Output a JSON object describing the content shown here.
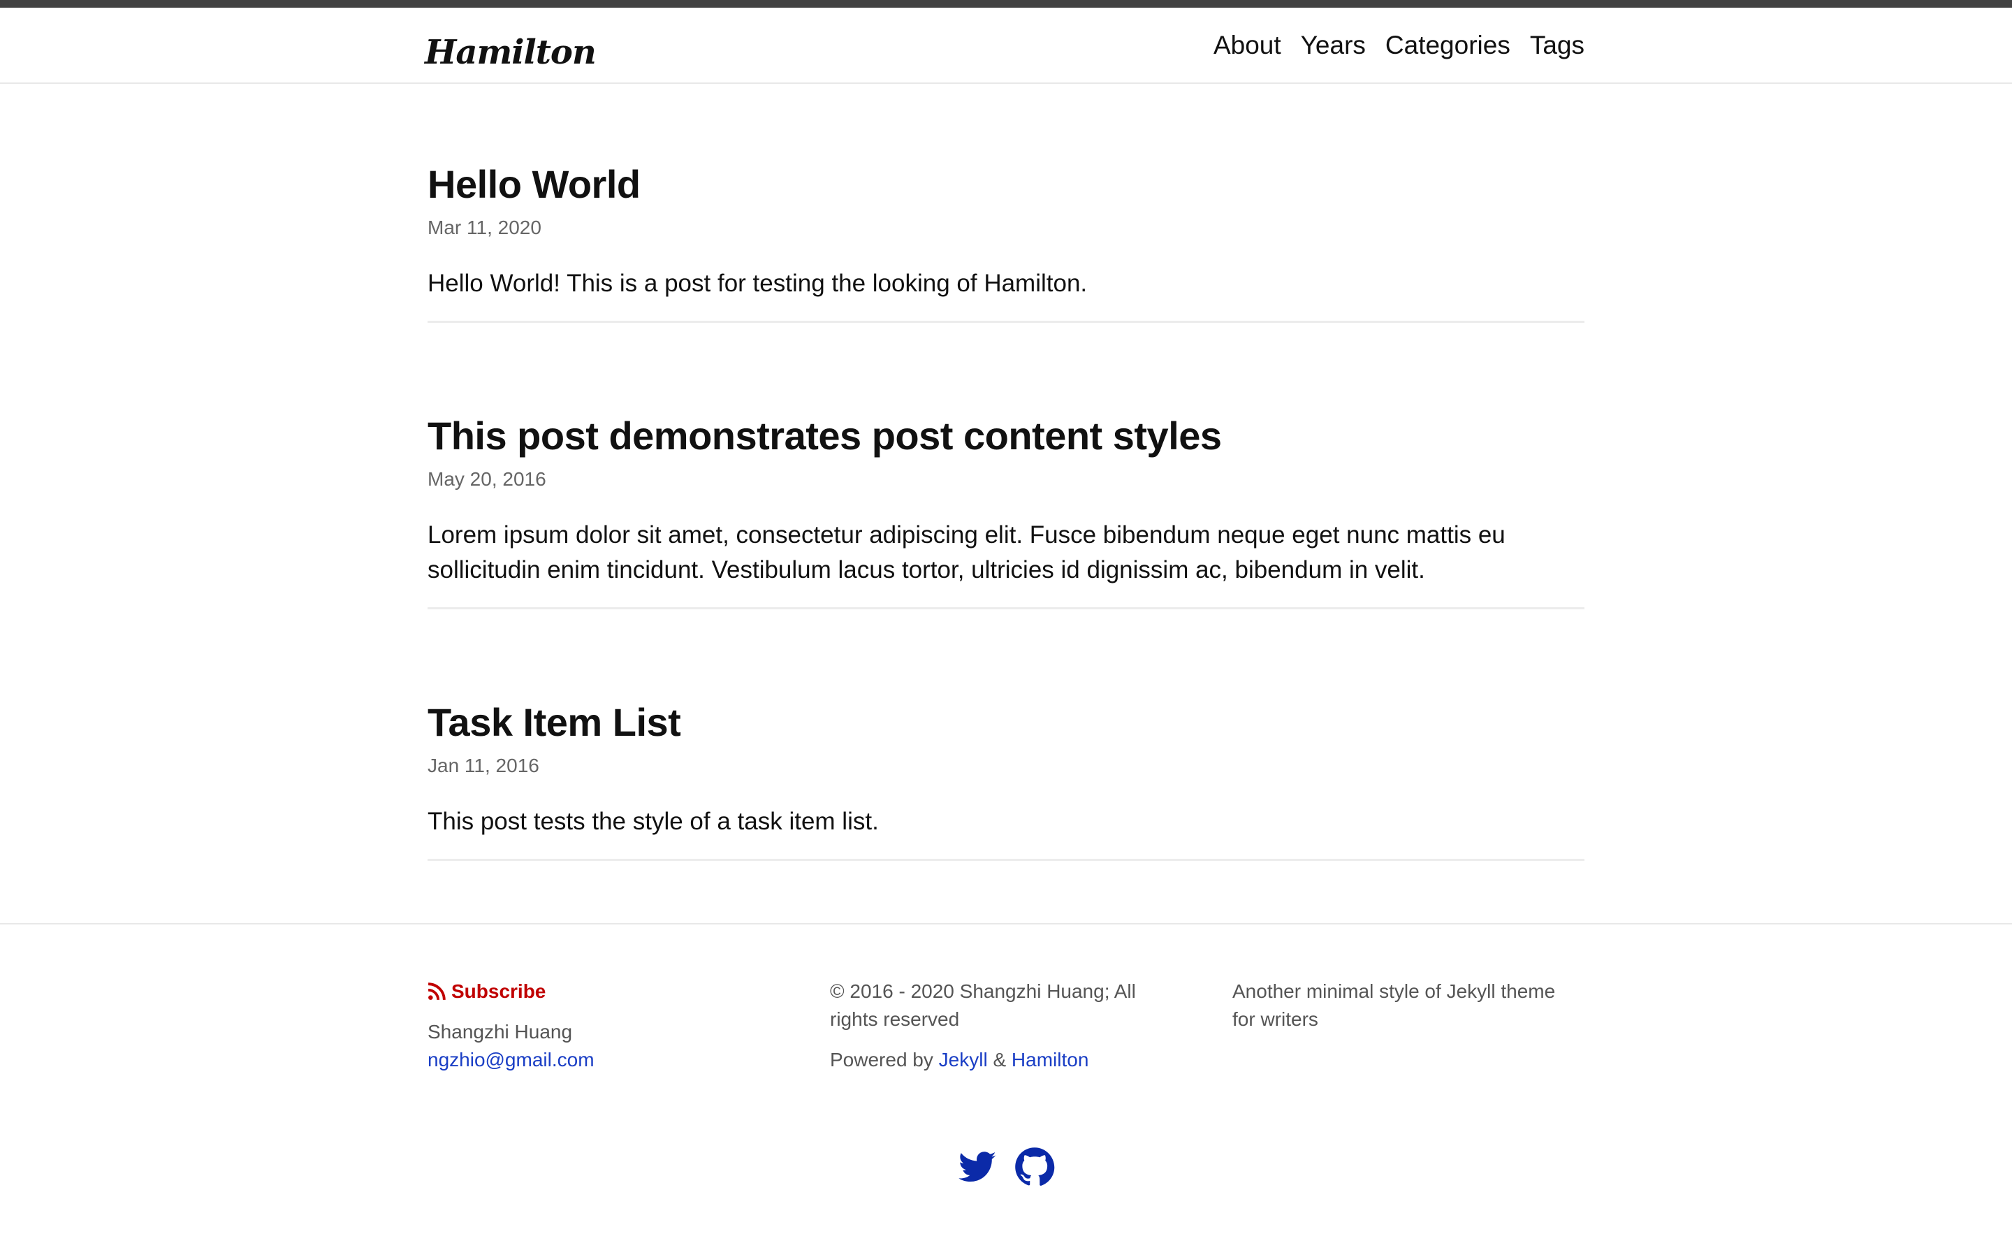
{
  "header": {
    "logo": "Hamilton",
    "nav": [
      "About",
      "Years",
      "Categories",
      "Tags"
    ]
  },
  "posts": [
    {
      "title": "Hello World",
      "date": "Mar 11, 2020",
      "excerpt": "Hello World! This is a post for testing the looking of Hamilton."
    },
    {
      "title": "This post demonstrates post content styles",
      "date": "May 20, 2016",
      "excerpt": "Lorem ipsum dolor sit amet, consectetur adipiscing elit. Fusce bibendum neque eget nunc mattis eu sollicitudin enim tincidunt. Vestibulum lacus tortor, ultricies id dignissim ac, bibendum in velit."
    },
    {
      "title": "Task Item List",
      "date": "Jan 11, 2016",
      "excerpt": "This post tests the style of a task item list."
    }
  ],
  "footer": {
    "subscribe": "Subscribe",
    "author": "Shangzhi Huang",
    "email": "ngzhio@gmail.com",
    "copyright": "© 2016 - 2020 Shangzhi Huang; All rights reserved",
    "powered_prefix": "Powered by",
    "powered_jekyll": "Jekyll",
    "powered_amp": "&",
    "powered_hamilton": "Hamilton",
    "description": "Another minimal style of Jekyll theme for writers",
    "social_icons": [
      "twitter-icon",
      "github-icon"
    ]
  },
  "colors": {
    "top_bar": "#424242",
    "subscribe": "#c00000",
    "link": "#1a3ec5",
    "social": "#0b2aa8"
  }
}
